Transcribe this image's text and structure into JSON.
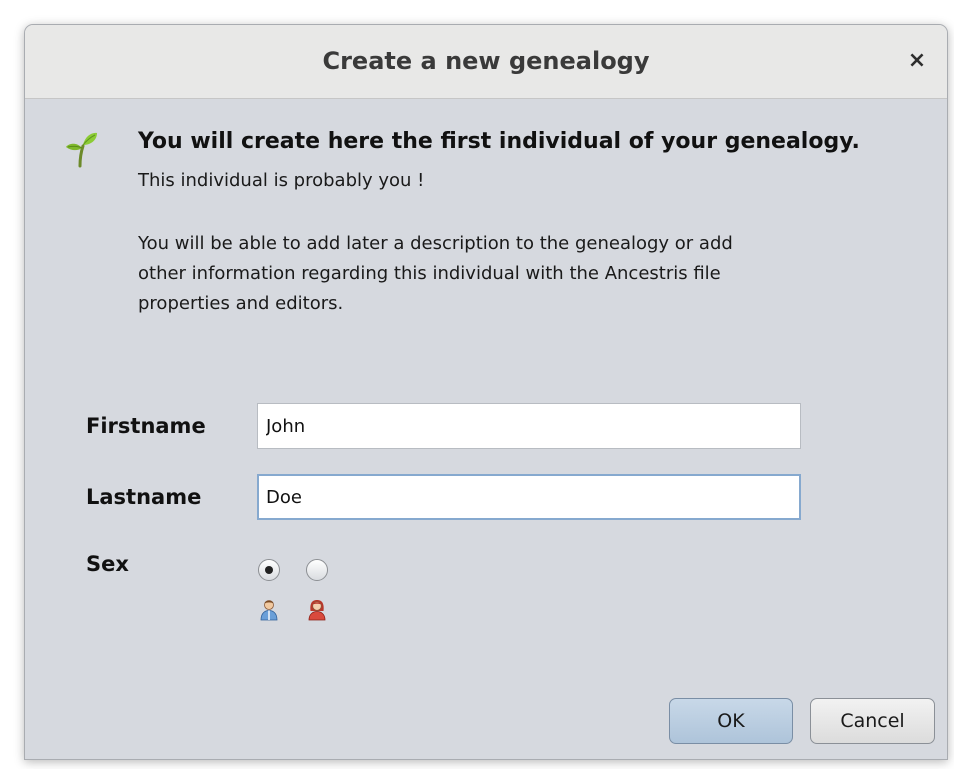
{
  "dialog": {
    "title": "Create a new genealogy",
    "close_label": "×"
  },
  "intro": {
    "icon": "plant-sprout-icon",
    "heading": "You will create here the first individual of your genealogy.",
    "subheading": "This individual is probably you !",
    "description_lines": [
      "You will be able to add later a description to the genealogy or add",
      "other information regarding this individual with the Ancestris file",
      "properties and editors."
    ]
  },
  "form": {
    "firstname": {
      "label": "Firstname",
      "value": "John"
    },
    "lastname": {
      "label": "Lastname",
      "value": "Doe"
    },
    "sex": {
      "label": "Sex",
      "selected": "male",
      "options": [
        {
          "value": "male",
          "icon": "male-person-icon",
          "selected": true
        },
        {
          "value": "female",
          "icon": "female-person-icon",
          "selected": false
        }
      ]
    }
  },
  "buttons": {
    "ok_label": "OK",
    "cancel_label": "Cancel"
  },
  "colors": {
    "dialog_background": "#d6d9df",
    "titlebar_background": "#e8e8e7",
    "focus_border": "#86a9cf",
    "ok_button": "#bcd0e3"
  }
}
